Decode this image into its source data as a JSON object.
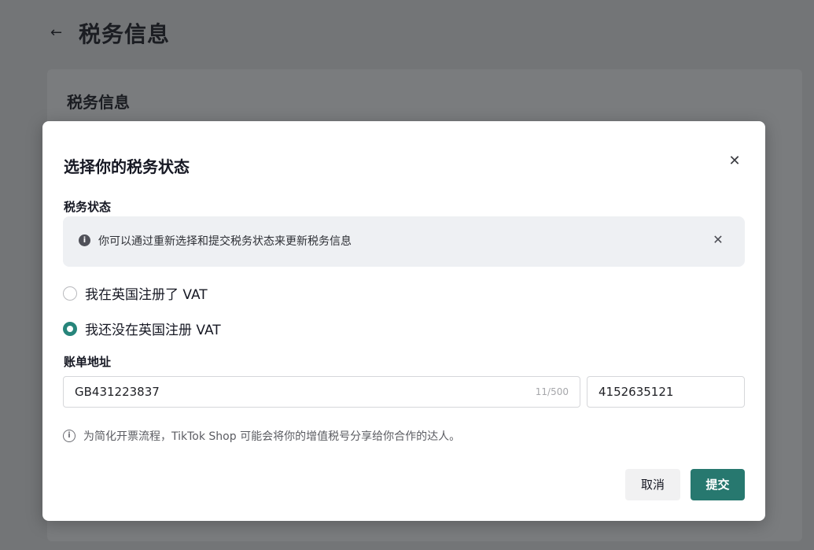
{
  "background": {
    "page_title": "税务信息",
    "card_title": "税务信息"
  },
  "modal": {
    "title": "选择你的税务状态",
    "close_icon": "close-icon",
    "tax_status_label": "税务状态",
    "notice": {
      "icon": "info-icon",
      "text": "你可以通过重新选择和提交税务状态来更新税务信息"
    },
    "options": [
      {
        "label": "我在英国注册了 VAT",
        "checked": false
      },
      {
        "label": "我还没在英国注册 VAT",
        "checked": true
      }
    ],
    "billing_label": "账单地址",
    "inputs": {
      "vat_value": "GB431223837",
      "vat_count": "11/500",
      "phone_value": "4152635121"
    },
    "hint": "为简化开票流程，TikTok Shop 可能会将你的增值税号分享给你合作的达人。",
    "buttons": {
      "cancel": "取消",
      "submit": "提交"
    },
    "colors": {
      "accent": "#27786f",
      "radio_checked": "#27857b"
    }
  }
}
